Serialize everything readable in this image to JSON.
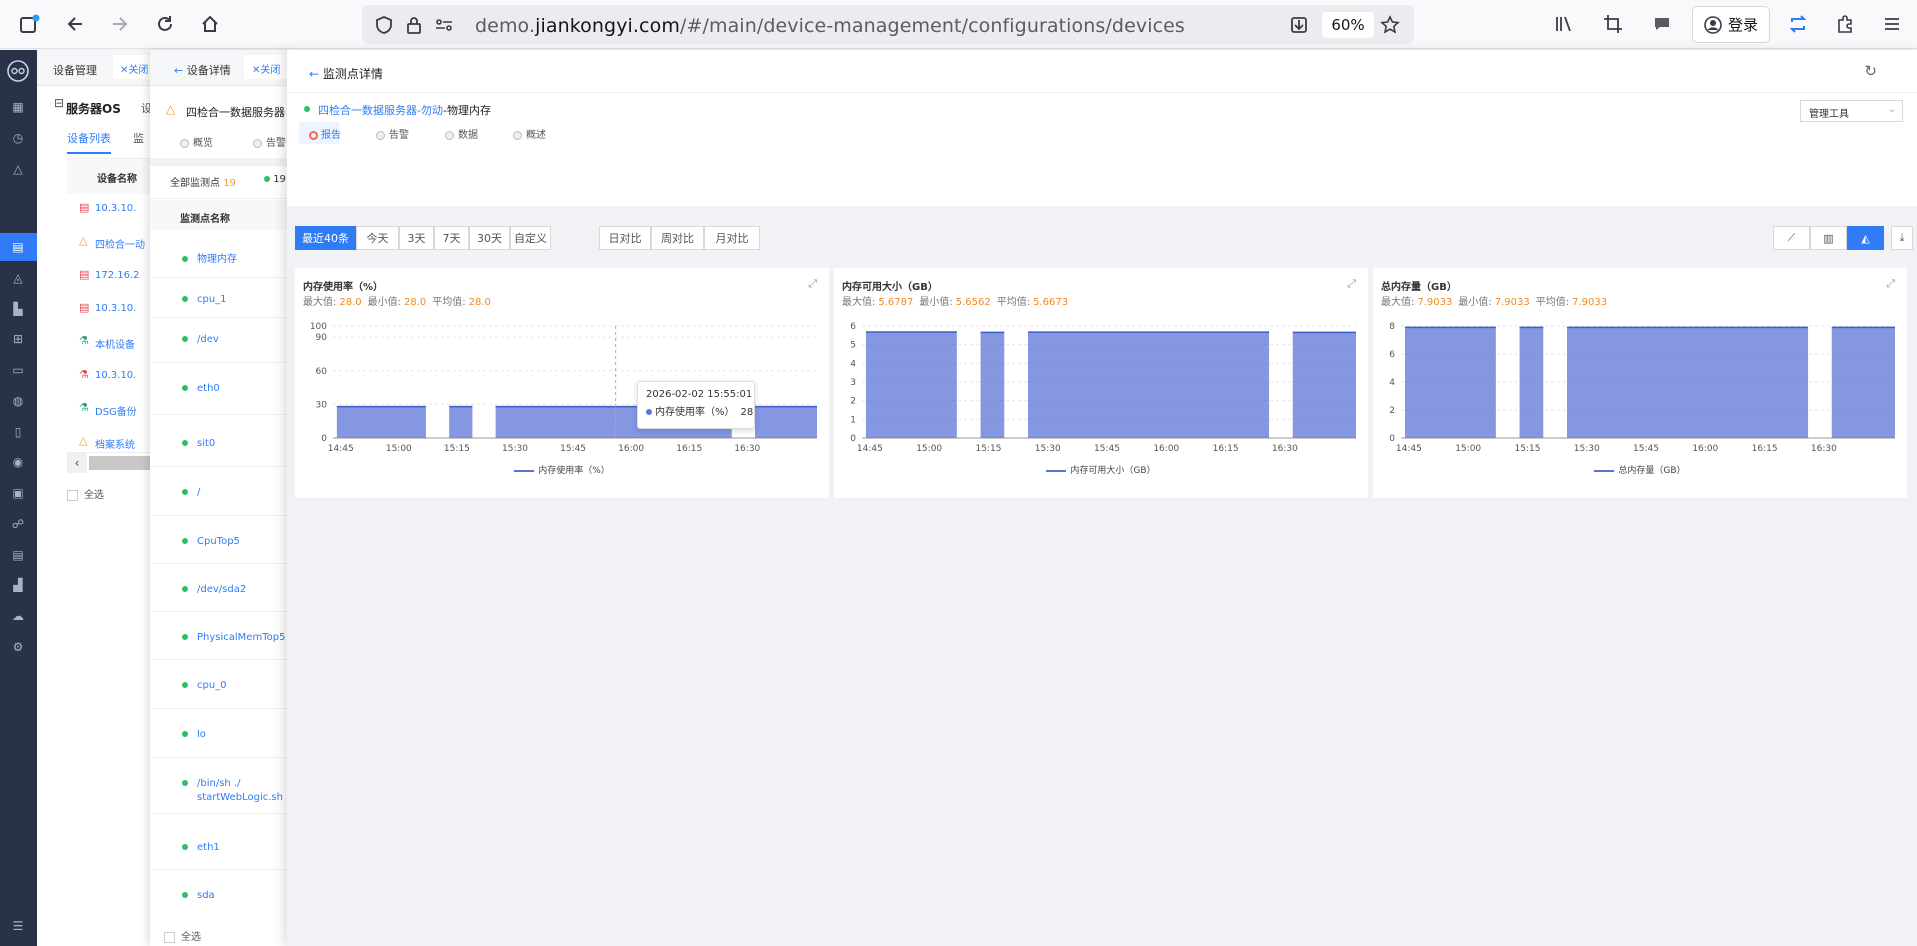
{
  "browser": {
    "url_prefix": "demo.",
    "url_domain": "jiankongyi.com",
    "url_path": "/#/main/device-management/configurations/devices",
    "zoom": "60%",
    "login_label": "登录"
  },
  "panel1": {
    "tab_title": "设备管理",
    "close_label": "关闭",
    "group_title": "服务器OS",
    "group_extra": "设",
    "tab_device_list": "设备列表",
    "tab_monitor": "监",
    "col_device_name": "设备名称",
    "devices": [
      {
        "name": "10.3.10.",
        "icon": "server-icon",
        "color": "#e5484d"
      },
      {
        "name": "四检合一动",
        "icon": "warning-triangle-icon",
        "color": "#f0a020"
      },
      {
        "name": "172.16.2",
        "icon": "server-icon",
        "color": "#e5484d"
      },
      {
        "name": "10.3.10.",
        "icon": "server-icon",
        "color": "#e5484d"
      },
      {
        "name": "本机设备",
        "icon": "flask-icon",
        "color": "#29a06a"
      },
      {
        "name": "10.3.10.",
        "icon": "flask-icon",
        "color": "#e5484d"
      },
      {
        "name": "DSG备份",
        "icon": "flask-icon",
        "color": "#29a06a"
      },
      {
        "name": "档案系统",
        "icon": "warning-triangle-icon",
        "color": "#f0a020"
      }
    ],
    "select_all": "全选"
  },
  "panel2": {
    "back_label": "设备详情",
    "close_label": "关闭",
    "device_name": "四检合一数据服务器",
    "tab_overview": "概览",
    "tab_alarm": "告警",
    "all_points_label": "全部监测点",
    "all_points_count": "19",
    "ok_count": "19",
    "col_point_name": "监测点名称",
    "points": [
      "物理内存",
      "cpu_1",
      "/dev",
      "eth0",
      "sit0",
      "/",
      "CpuTop5",
      "/dev/sda2",
      "PhysicalMemTop5",
      "cpu_0",
      "lo",
      "/bin/sh ./ startWebLogic.sh",
      "eth1",
      "sda"
    ],
    "select_all": "全选"
  },
  "panel3": {
    "back_label": "监测点详情",
    "device_link": "四检合一数据服务器-勿动",
    "point_name": "-物理内存",
    "tabs": [
      "报告",
      "告警",
      "数据",
      "概述"
    ],
    "tool_select": "管理工具",
    "range_buttons": [
      "最近40条",
      "今天",
      "3天",
      "7天",
      "30天",
      "自定义"
    ],
    "compare_buttons": [
      "日对比",
      "周对比",
      "月对比"
    ],
    "view_icons": [
      "line-chart-icon",
      "bar-chart-icon",
      "area-chart-icon",
      "download-icon"
    ]
  },
  "charts": [
    {
      "title": "内存使用率（%）",
      "max_label": "最大值:",
      "max": "28.0",
      "min_label": "最小值:",
      "min": "28.0",
      "avg_label": "平均值:",
      "avg": "28.0",
      "legend": "内存使用率（%）",
      "tooltip_time": "2026-02-02 15:55:01",
      "tooltip_label": "内存使用率（%）",
      "tooltip_value": "28"
    },
    {
      "title": "内存可用大小（GB）",
      "max_label": "最大值:",
      "max": "5.6787",
      "min_label": "最小值:",
      "min": "5.6562",
      "avg_label": "平均值:",
      "avg": "5.6673",
      "legend": "内存可用大小（GB）"
    },
    {
      "title": "总内存量（GB）",
      "max_label": "最大值:",
      "max": "7.9033",
      "min_label": "最小值:",
      "min": "7.9033",
      "avg_label": "平均值:",
      "avg": "7.9033",
      "legend": "总内存量（GB）"
    }
  ],
  "chart_data": [
    {
      "type": "area",
      "title": "内存使用率（%）",
      "x_ticks": [
        "14:45",
        "15:00",
        "15:15",
        "15:30",
        "15:45",
        "16:00",
        "16:15",
        "16:30"
      ],
      "y_ticks": [
        0,
        30,
        60,
        90,
        100
      ],
      "ylim": [
        0,
        100
      ],
      "xlim_minutes": [
        0,
        125
      ],
      "segments": [
        {
          "start": 1,
          "end": 24,
          "value": 28.0
        },
        {
          "start": 30,
          "end": 36,
          "value": 28.0
        },
        {
          "start": 42,
          "end": 103,
          "value": 28.0
        },
        {
          "start": 109,
          "end": 125,
          "value": 28.0
        }
      ],
      "color": "#5b74d6",
      "grid": true
    },
    {
      "type": "area",
      "title": "内存可用大小（GB）",
      "x_ticks": [
        "14:45",
        "15:00",
        "15:15",
        "15:30",
        "15:45",
        "16:00",
        "16:15",
        "16:30"
      ],
      "y_ticks": [
        0,
        1,
        2,
        3,
        4,
        5,
        6
      ],
      "ylim": [
        0,
        6
      ],
      "xlim_minutes": [
        0,
        125
      ],
      "segments": [
        {
          "start": 1,
          "end": 24,
          "value": 5.6787
        },
        {
          "start": 30,
          "end": 36,
          "value": 5.66
        },
        {
          "start": 42,
          "end": 103,
          "value": 5.67
        },
        {
          "start": 109,
          "end": 125,
          "value": 5.6562
        }
      ],
      "color": "#5b74d6",
      "grid": true
    },
    {
      "type": "area",
      "title": "总内存量（GB）",
      "x_ticks": [
        "14:45",
        "15:00",
        "15:15",
        "15:30",
        "15:45",
        "16:00",
        "16:15",
        "16:30"
      ],
      "y_ticks": [
        0,
        2,
        4,
        6,
        8
      ],
      "ylim": [
        0,
        8
      ],
      "xlim_minutes": [
        0,
        125
      ],
      "segments": [
        {
          "start": 1,
          "end": 24,
          "value": 7.9033
        },
        {
          "start": 30,
          "end": 36,
          "value": 7.9033
        },
        {
          "start": 42,
          "end": 103,
          "value": 7.9033
        },
        {
          "start": 109,
          "end": 125,
          "value": 7.9033
        }
      ],
      "color": "#5b74d6",
      "grid": true
    }
  ]
}
